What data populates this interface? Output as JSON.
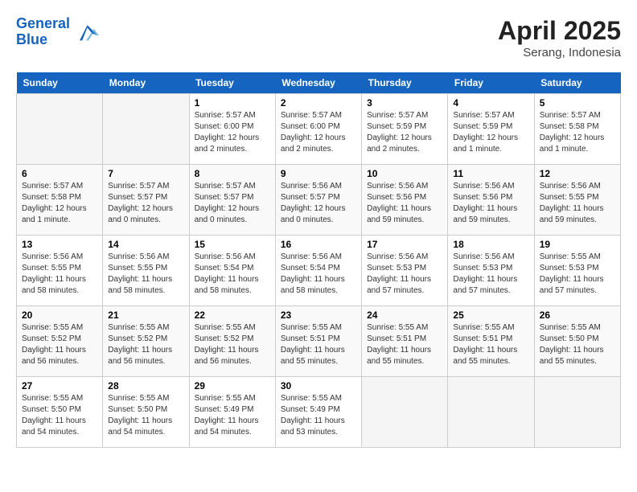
{
  "header": {
    "logo_line1": "General",
    "logo_line2": "Blue",
    "month": "April 2025",
    "location": "Serang, Indonesia"
  },
  "weekdays": [
    "Sunday",
    "Monday",
    "Tuesday",
    "Wednesday",
    "Thursday",
    "Friday",
    "Saturday"
  ],
  "weeks": [
    [
      {
        "day": "",
        "info": ""
      },
      {
        "day": "",
        "info": ""
      },
      {
        "day": "1",
        "info": "Sunrise: 5:57 AM\nSunset: 6:00 PM\nDaylight: 12 hours\nand 2 minutes."
      },
      {
        "day": "2",
        "info": "Sunrise: 5:57 AM\nSunset: 6:00 PM\nDaylight: 12 hours\nand 2 minutes."
      },
      {
        "day": "3",
        "info": "Sunrise: 5:57 AM\nSunset: 5:59 PM\nDaylight: 12 hours\nand 2 minutes."
      },
      {
        "day": "4",
        "info": "Sunrise: 5:57 AM\nSunset: 5:59 PM\nDaylight: 12 hours\nand 1 minute."
      },
      {
        "day": "5",
        "info": "Sunrise: 5:57 AM\nSunset: 5:58 PM\nDaylight: 12 hours\nand 1 minute."
      }
    ],
    [
      {
        "day": "6",
        "info": "Sunrise: 5:57 AM\nSunset: 5:58 PM\nDaylight: 12 hours\nand 1 minute."
      },
      {
        "day": "7",
        "info": "Sunrise: 5:57 AM\nSunset: 5:57 PM\nDaylight: 12 hours\nand 0 minutes."
      },
      {
        "day": "8",
        "info": "Sunrise: 5:57 AM\nSunset: 5:57 PM\nDaylight: 12 hours\nand 0 minutes."
      },
      {
        "day": "9",
        "info": "Sunrise: 5:56 AM\nSunset: 5:57 PM\nDaylight: 12 hours\nand 0 minutes."
      },
      {
        "day": "10",
        "info": "Sunrise: 5:56 AM\nSunset: 5:56 PM\nDaylight: 11 hours\nand 59 minutes."
      },
      {
        "day": "11",
        "info": "Sunrise: 5:56 AM\nSunset: 5:56 PM\nDaylight: 11 hours\nand 59 minutes."
      },
      {
        "day": "12",
        "info": "Sunrise: 5:56 AM\nSunset: 5:55 PM\nDaylight: 11 hours\nand 59 minutes."
      }
    ],
    [
      {
        "day": "13",
        "info": "Sunrise: 5:56 AM\nSunset: 5:55 PM\nDaylight: 11 hours\nand 58 minutes."
      },
      {
        "day": "14",
        "info": "Sunrise: 5:56 AM\nSunset: 5:55 PM\nDaylight: 11 hours\nand 58 minutes."
      },
      {
        "day": "15",
        "info": "Sunrise: 5:56 AM\nSunset: 5:54 PM\nDaylight: 11 hours\nand 58 minutes."
      },
      {
        "day": "16",
        "info": "Sunrise: 5:56 AM\nSunset: 5:54 PM\nDaylight: 11 hours\nand 58 minutes."
      },
      {
        "day": "17",
        "info": "Sunrise: 5:56 AM\nSunset: 5:53 PM\nDaylight: 11 hours\nand 57 minutes."
      },
      {
        "day": "18",
        "info": "Sunrise: 5:56 AM\nSunset: 5:53 PM\nDaylight: 11 hours\nand 57 minutes."
      },
      {
        "day": "19",
        "info": "Sunrise: 5:55 AM\nSunset: 5:53 PM\nDaylight: 11 hours\nand 57 minutes."
      }
    ],
    [
      {
        "day": "20",
        "info": "Sunrise: 5:55 AM\nSunset: 5:52 PM\nDaylight: 11 hours\nand 56 minutes."
      },
      {
        "day": "21",
        "info": "Sunrise: 5:55 AM\nSunset: 5:52 PM\nDaylight: 11 hours\nand 56 minutes."
      },
      {
        "day": "22",
        "info": "Sunrise: 5:55 AM\nSunset: 5:52 PM\nDaylight: 11 hours\nand 56 minutes."
      },
      {
        "day": "23",
        "info": "Sunrise: 5:55 AM\nSunset: 5:51 PM\nDaylight: 11 hours\nand 55 minutes."
      },
      {
        "day": "24",
        "info": "Sunrise: 5:55 AM\nSunset: 5:51 PM\nDaylight: 11 hours\nand 55 minutes."
      },
      {
        "day": "25",
        "info": "Sunrise: 5:55 AM\nSunset: 5:51 PM\nDaylight: 11 hours\nand 55 minutes."
      },
      {
        "day": "26",
        "info": "Sunrise: 5:55 AM\nSunset: 5:50 PM\nDaylight: 11 hours\nand 55 minutes."
      }
    ],
    [
      {
        "day": "27",
        "info": "Sunrise: 5:55 AM\nSunset: 5:50 PM\nDaylight: 11 hours\nand 54 minutes."
      },
      {
        "day": "28",
        "info": "Sunrise: 5:55 AM\nSunset: 5:50 PM\nDaylight: 11 hours\nand 54 minutes."
      },
      {
        "day": "29",
        "info": "Sunrise: 5:55 AM\nSunset: 5:49 PM\nDaylight: 11 hours\nand 54 minutes."
      },
      {
        "day": "30",
        "info": "Sunrise: 5:55 AM\nSunset: 5:49 PM\nDaylight: 11 hours\nand 53 minutes."
      },
      {
        "day": "",
        "info": ""
      },
      {
        "day": "",
        "info": ""
      },
      {
        "day": "",
        "info": ""
      }
    ]
  ]
}
